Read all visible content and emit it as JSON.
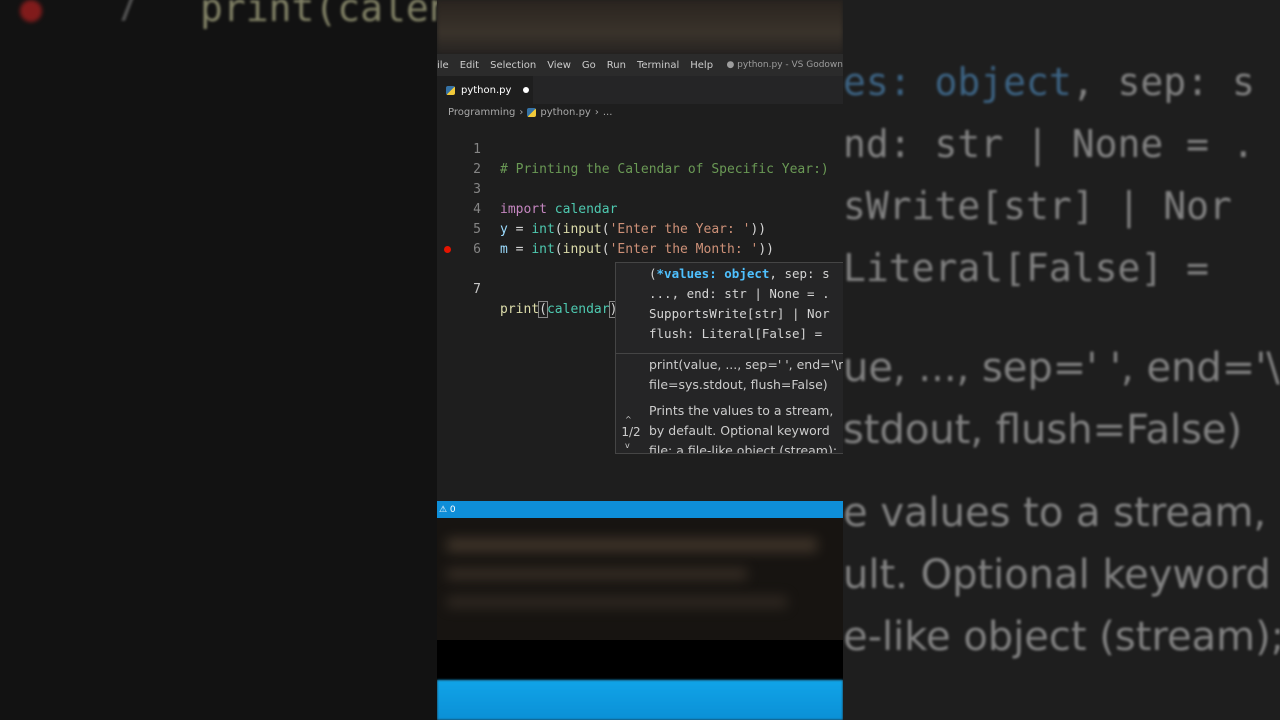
{
  "window": {
    "title": "● python.py - VS Godown"
  },
  "menu": [
    "ile",
    "Edit",
    "Selection",
    "View",
    "Go",
    "Run",
    "Terminal",
    "Help"
  ],
  "tab": {
    "label": "python.py"
  },
  "breadcrumb": {
    "folder": "Programming",
    "file": "python.py",
    "more": "..."
  },
  "editor": {
    "line_numbers": [
      "1",
      "2",
      "3",
      "4",
      "5",
      "6",
      "7"
    ],
    "lines": {
      "l1": "# Printing the Calendar of Specific Year:)",
      "l3_kw": "import",
      "l3_mod": "calendar",
      "l4_var": "y",
      "l4_eq": " = ",
      "l4_fn1": "int",
      "l4_p1": "(",
      "l4_fn2": "input",
      "l4_p2": "(",
      "l4_str": "'Enter the Year: '",
      "l4_end": "))",
      "l5_var": "m",
      "l5_eq": " = ",
      "l5_fn1": "int",
      "l5_p1": "(",
      "l5_fn2": "input",
      "l5_p2": "(",
      "l5_str": "'Enter the Month: '",
      "l5_end": "))",
      "l7_fn": "print",
      "l7_open": "(",
      "l7_mod": "calendar",
      "l7_close": ")"
    },
    "breakpoint_line": "7"
  },
  "signature_help": {
    "sig_line1_a": "(",
    "sig_line1_param": "*values: object",
    "sig_line1_b": ", sep: s",
    "sig_line2": "..., end: str | None = .",
    "sig_line3": "SupportsWrite[str] | Nor",
    "sig_line4": "flush: Literal[False] = ",
    "doc1": "print(value, ..., sep=' ', end='\\n",
    "doc2": "file=sys.stdout, flush=False)",
    "doc3": "Prints the values to a stream,",
    "doc4": "by default. Optional keyword",
    "doc5": "file: a file-like object (stream);",
    "counter": "1/2"
  },
  "statusbar": {
    "warnings": "⚠ 0"
  },
  "background_left": {
    "line_number": "7",
    "code": "print(calen"
  },
  "background_right": {
    "l1a": "es: ",
    "l1b": "object",
    "l1c": ", sep: s",
    "l2": "nd: str | None = .",
    "l3": "sWrite[str] | Nor",
    "l4": "Literal[False] = ",
    "p1": "ue, ..., sep=' ', end='\\n",
    "p2": "stdout, flush=False)",
    "p3": "e values to a stream,",
    "p4": "ult. Optional keyword",
    "p5": "e-like object (stream);"
  }
}
